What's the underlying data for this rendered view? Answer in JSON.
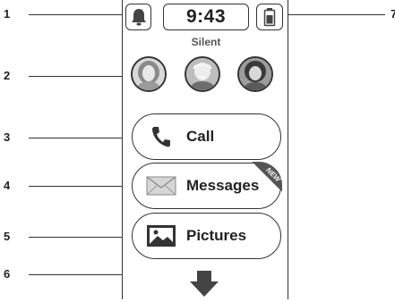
{
  "callouts": [
    "1",
    "2",
    "3",
    "4",
    "5",
    "6",
    "7"
  ],
  "status_bar": {
    "time": "9:43",
    "bell_icon": "bell-silent-icon",
    "battery_icon": "battery-icon"
  },
  "mode_label": "Silent",
  "contacts": [
    {
      "icon": "contact-photo-woman"
    },
    {
      "icon": "contact-photo-man"
    },
    {
      "icon": "contact-photo-girl"
    }
  ],
  "apps": {
    "call": {
      "label": "Call",
      "icon": "phone-handset-icon"
    },
    "messages": {
      "label": "Messages",
      "icon": "envelope-icon",
      "badge": "NEW"
    },
    "pictures": {
      "label": "Pictures",
      "icon": "picture-icon"
    }
  },
  "scroll": {
    "icon": "arrow-down-icon"
  },
  "colors": {
    "ink": "#333333",
    "badge": "#555555"
  }
}
